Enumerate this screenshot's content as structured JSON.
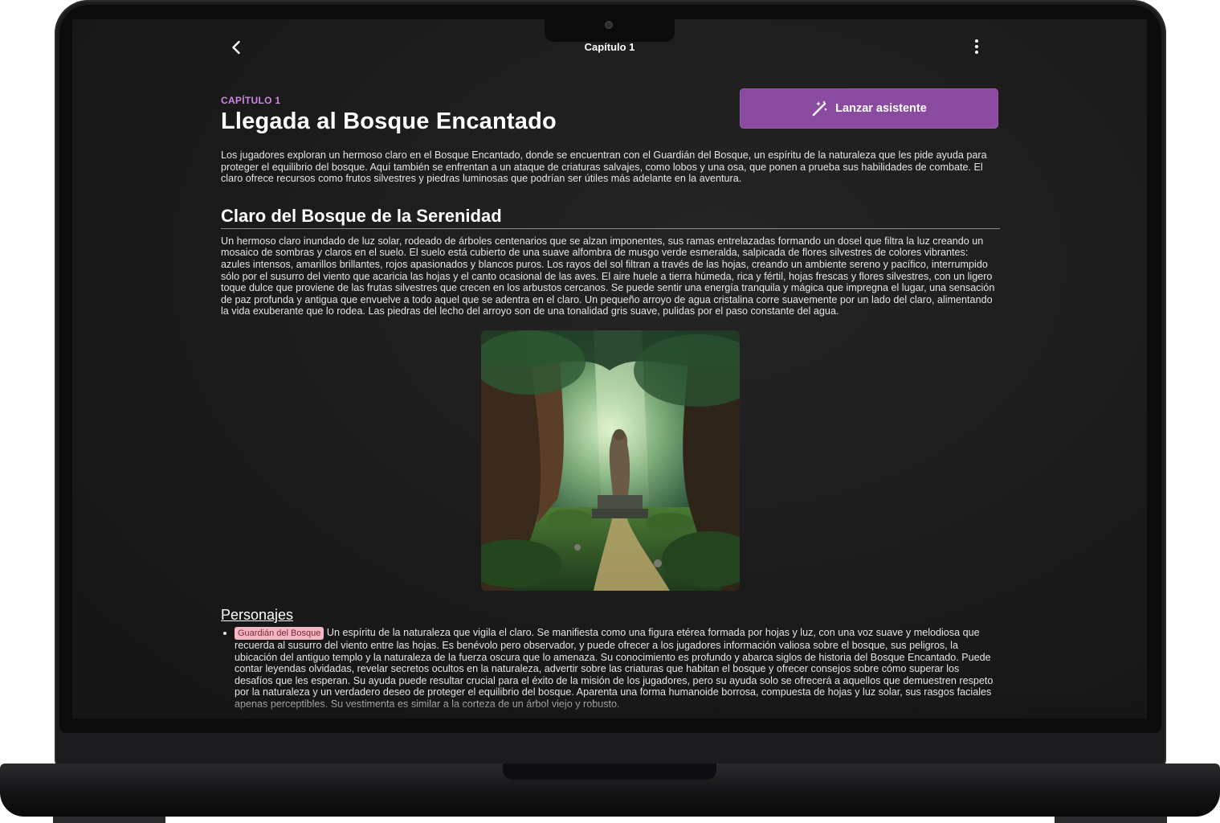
{
  "app": {
    "top_title": "Capítulo 1"
  },
  "chapter": {
    "eyebrow": "CAPÍTULO 1",
    "title": "Llegada al Bosque Encantado",
    "assistant_button": "Lanzar asistente",
    "summary": "Los jugadores exploran un hermoso claro en el Bosque Encantado, donde se encuentran con el Guardián del Bosque, un espíritu de la naturaleza que les pide ayuda para proteger el equilibrio del bosque. Aquí también se enfrentan a un ataque de criaturas salvajes, como lobos y una osa, que ponen a prueba sus habilidades de combate. El claro ofrece recursos como frutos silvestres y piedras luminosas que podrían ser útiles más adelante en la aventura."
  },
  "scene": {
    "title": "Claro del Bosque de la Serenidad",
    "description": "Un hermoso claro inundado de luz solar, rodeado de árboles centenarios que se alzan imponentes, sus ramas entrelazadas formando un dosel que filtra la luz creando un mosaico de sombras y claros en el suelo.  El suelo está cubierto de una suave alfombra de musgo verde esmeralda, salpicada de flores silvestres de colores vibrantes: azules intensos, amarillos brillantes, rojos apasionados y blancos puros.  Los rayos del sol filtran a través de las hojas, creando un ambiente sereno y pacífico, interrumpido sólo por el susurro del viento que acaricia las hojas y el canto ocasional de las aves. El aire huele a tierra húmeda, rica y fértil, hojas frescas y flores silvestres, con un ligero toque dulce que proviene de las frutas silvestres que crecen en los arbustos cercanos. Se puede sentir una energía tranquila y mágica que impregna el lugar, una sensación de paz profunda y antigua que envuelve a todo aquel que se adentra en el claro.  Un pequeño arroyo de agua cristalina corre suavemente por un lado del claro, alimentando la vida exuberante que lo rodea. Las piedras del lecho del arroyo son de una tonalidad gris suave, pulidas por el paso constante del agua.",
    "image_subject": "forest-clearing-guardian-statue"
  },
  "characters": {
    "heading": "Personajes",
    "items": [
      {
        "tag": "Guardián del Bosque",
        "description": "Un espíritu de la naturaleza que vigila el claro. Se manifiesta como una figura etérea formada por hojas y luz, con una voz suave y melodiosa que recuerda al susurro del viento entre las hojas.  Es benévolo pero observador, y puede ofrecer a los jugadores información valiosa sobre el bosque, sus peligros, la ubicación del antiguo templo y la naturaleza de la fuerza oscura que lo amenaza. Su conocimiento es profundo y abarca siglos de historia del Bosque Encantado. Puede contar leyendas olvidadas, revelar secretos ocultos en la naturaleza, advertir sobre las criaturas que habitan el bosque y ofrecer consejos sobre cómo superar los desafíos que les esperan. Su ayuda puede resultar crucial para el éxito de la misión de los jugadores, pero su ayuda solo se ofrecerá a aquellos que demuestren respeto por la naturaleza y un verdadero deseo de proteger el equilibrio del bosque.  Aparenta una forma humanoide borrosa, compuesta de hojas y luz solar, sus rasgos faciales apenas perceptibles.  Su vestimenta es similar a la corteza de un árbol viejo y robusto."
      }
    ]
  },
  "colors": {
    "accent": "#8a4aa0",
    "eyebrow": "#c98ae0",
    "tag_bg": "#f3b8c3"
  }
}
